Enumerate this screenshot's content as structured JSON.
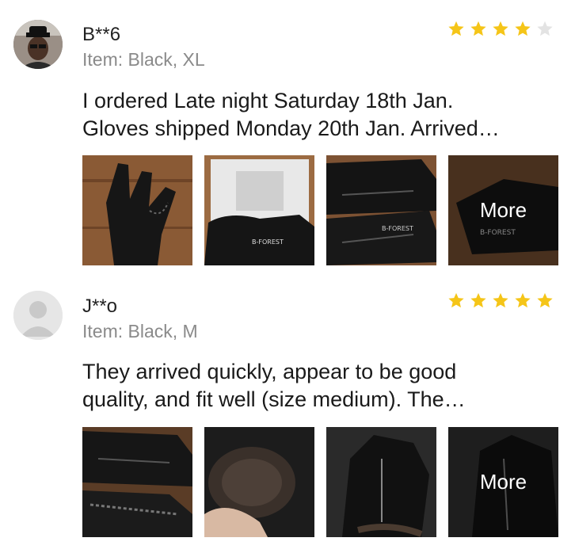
{
  "reviews": [
    {
      "name": "B**6",
      "item": "Item: Black, XL",
      "text_line1": "I ordered Late night Saturday 18th Jan.",
      "text_line2": "Gloves shipped Monday 20th Jan. Arrived…",
      "rating": 4,
      "rating_max": 5,
      "more_label": "More",
      "photos": [
        "glove-photo",
        "glove-package-photo",
        "gloves-pair-photo",
        "glove-more-photo"
      ]
    },
    {
      "name": "J**o",
      "item": "Item: Black, M",
      "text_line1": "They arrived quickly, appear to be good",
      "text_line2": "quality, and fit well (size medium). The…",
      "rating": 5,
      "rating_max": 5,
      "more_label": "More",
      "photos": [
        "gloves-pair-photo",
        "glove-lining-photo",
        "glove-zipper-photo",
        "glove-more-photo"
      ]
    }
  ],
  "colors": {
    "star_on": "#f5c518",
    "star_off": "#e3e3e3",
    "item_text": "#8a8a8a"
  }
}
